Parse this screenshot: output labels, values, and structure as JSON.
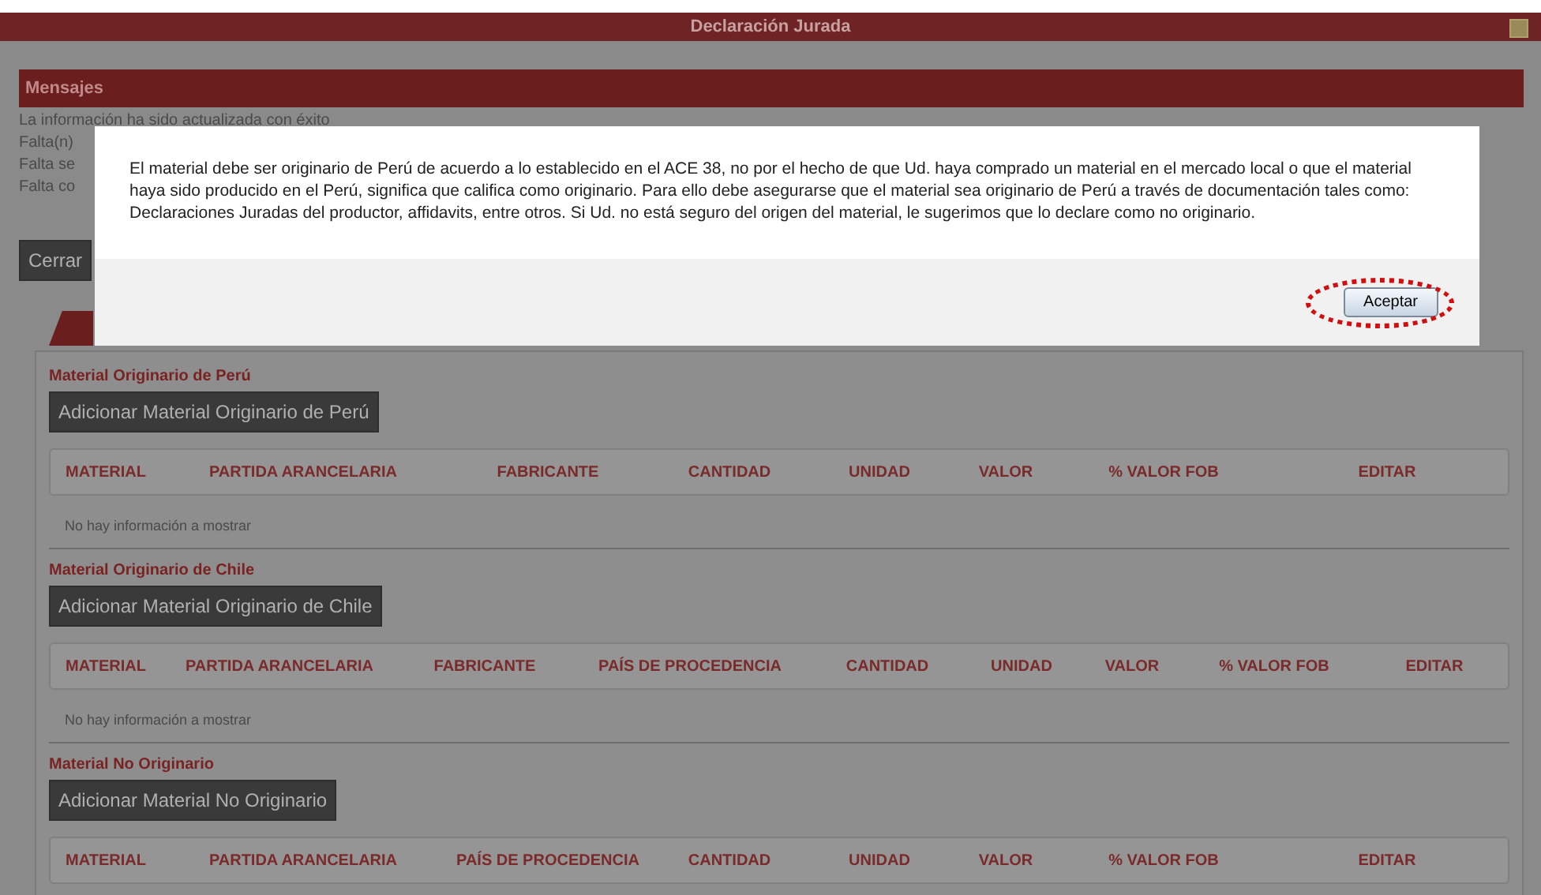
{
  "window": {
    "title": "Declaración Jurada"
  },
  "messages": {
    "title": "Mensajes",
    "lines": [
      "La información ha sido actualizada con éxito",
      "Falta(n)",
      "Falta se",
      "Falta co"
    ]
  },
  "close_button": "Cerrar",
  "sections": [
    {
      "title": "Material Originario de Perú",
      "add_button": "Adicionar Material Originario de Perú",
      "columns": [
        "MATERIAL",
        "PARTIDA ARANCELARIA",
        "FABRICANTE",
        "CANTIDAD",
        "UNIDAD",
        "VALOR",
        "% VALOR FOB",
        "EDITAR"
      ],
      "empty_text": "No hay información a mostrar"
    },
    {
      "title": "Material Originario de Chile",
      "add_button": "Adicionar Material Originario de Chile",
      "columns": [
        "MATERIAL",
        "PARTIDA ARANCELARIA",
        "FABRICANTE",
        "PAÍS DE PROCEDENCIA",
        "CANTIDAD",
        "UNIDAD",
        "VALOR",
        "% VALOR FOB",
        "EDITAR"
      ],
      "empty_text": "No hay información a mostrar"
    },
    {
      "title": "Material No Originario",
      "add_button": "Adicionar Material No Originario",
      "columns": [
        "MATERIAL",
        "PARTIDA ARANCELARIA",
        "PAÍS DE PROCEDENCIA",
        "CANTIDAD",
        "UNIDAD",
        "VALOR",
        "% VALOR FOB",
        "EDITAR"
      ]
    }
  ],
  "modal": {
    "text": "El material debe ser originario de Perú de acuerdo a lo establecido en el ACE 38, no por el hecho de que Ud. haya comprado un material en el mercado local o que el material haya sido producido en el Perú, significa que califica como originario. Para ello debe asegurarse que el material sea originario de Perú a través de documentación tales como: Declaraciones Juradas del productor, affidavits, entre otros. Si Ud. no está seguro del origen del material, le sugerimos que lo declare como no originario.",
    "button": "Aceptar"
  }
}
